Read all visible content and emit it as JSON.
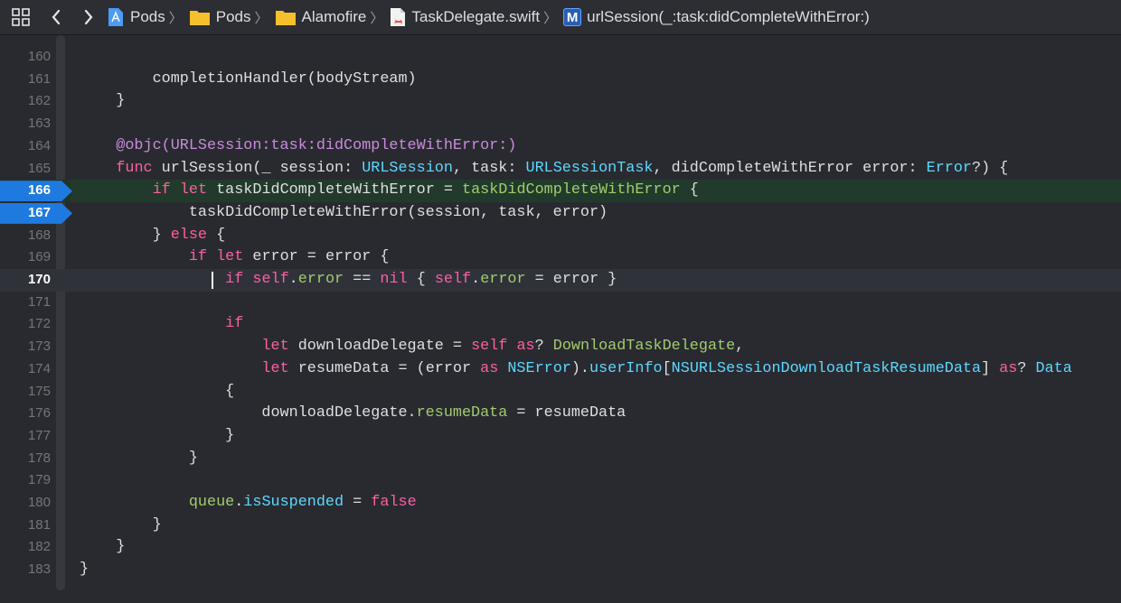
{
  "jumpbar": {
    "crumbs": [
      {
        "label": "Pods",
        "icon": "project-icon"
      },
      {
        "label": "Pods",
        "icon": "folder-icon"
      },
      {
        "label": "Alamofire",
        "icon": "folder-icon"
      },
      {
        "label": "TaskDelegate.swift",
        "icon": "swift-file-icon"
      },
      {
        "label": "urlSession(_:task:didCompleteWithError:)",
        "icon": "method-icon"
      }
    ],
    "method_badge": "M"
  },
  "colors": {
    "breakpoint": "#1f7ae0",
    "execution_line": "#223a2b",
    "background": "#292a30"
  },
  "editor": {
    "breakpoint_lines": [
      166,
      167
    ],
    "current_line": 170,
    "lines": [
      {
        "n": "160",
        "tokens": []
      },
      {
        "n": "161",
        "tokens": [
          {
            "t": "        completionHandler(bodyStream)",
            "c": ""
          }
        ]
      },
      {
        "n": "162",
        "tokens": [
          {
            "t": "    }",
            "c": ""
          }
        ]
      },
      {
        "n": "163",
        "tokens": []
      },
      {
        "n": "164",
        "tokens": [
          {
            "t": "    @objc(URLSession:task:didCompleteWithError:)",
            "c": "att"
          }
        ]
      },
      {
        "n": "165",
        "tokens": [
          {
            "t": "    ",
            "c": ""
          },
          {
            "t": "func",
            "c": "kw"
          },
          {
            "t": " urlSession(_ session: ",
            "c": ""
          },
          {
            "t": "URLSession",
            "c": "ty"
          },
          {
            "t": ", task: ",
            "c": ""
          },
          {
            "t": "URLSessionTask",
            "c": "ty"
          },
          {
            "t": ", didCompleteWithError error: ",
            "c": ""
          },
          {
            "t": "Error",
            "c": "ty"
          },
          {
            "t": "?) {",
            "c": ""
          }
        ]
      },
      {
        "n": "166",
        "tokens": [
          {
            "t": "        ",
            "c": ""
          },
          {
            "t": "if",
            "c": "kw"
          },
          {
            "t": " ",
            "c": ""
          },
          {
            "t": "let",
            "c": "kw"
          },
          {
            "t": " taskDidCompleteWithError = ",
            "c": ""
          },
          {
            "t": "taskDidCompleteWithError",
            "c": "mem"
          },
          {
            "t": " {",
            "c": ""
          }
        ]
      },
      {
        "n": "167",
        "tokens": [
          {
            "t": "            taskDidCompleteWithError(session, task, error)",
            "c": ""
          }
        ]
      },
      {
        "n": "168",
        "tokens": [
          {
            "t": "        } ",
            "c": ""
          },
          {
            "t": "else",
            "c": "kw"
          },
          {
            "t": " {",
            "c": ""
          }
        ]
      },
      {
        "n": "169",
        "tokens": [
          {
            "t": "            ",
            "c": ""
          },
          {
            "t": "if",
            "c": "kw"
          },
          {
            "t": " ",
            "c": ""
          },
          {
            "t": "let",
            "c": "kw"
          },
          {
            "t": " error = error {",
            "c": ""
          }
        ]
      },
      {
        "n": "170",
        "tokens": [
          {
            "t": "                ",
            "c": ""
          },
          {
            "t": "if",
            "c": "kw"
          },
          {
            "t": " ",
            "c": ""
          },
          {
            "t": "self",
            "c": "kw"
          },
          {
            "t": ".",
            "c": ""
          },
          {
            "t": "error",
            "c": "mem"
          },
          {
            "t": " == ",
            "c": ""
          },
          {
            "t": "nil",
            "c": "kw"
          },
          {
            "t": " { ",
            "c": ""
          },
          {
            "t": "self",
            "c": "kw"
          },
          {
            "t": ".",
            "c": ""
          },
          {
            "t": "error",
            "c": "mem"
          },
          {
            "t": " = error }",
            "c": ""
          }
        ]
      },
      {
        "n": "171",
        "tokens": []
      },
      {
        "n": "172",
        "tokens": [
          {
            "t": "                ",
            "c": ""
          },
          {
            "t": "if",
            "c": "kw"
          }
        ]
      },
      {
        "n": "173",
        "tokens": [
          {
            "t": "                    ",
            "c": ""
          },
          {
            "t": "let",
            "c": "kw"
          },
          {
            "t": " downloadDelegate = ",
            "c": ""
          },
          {
            "t": "self",
            "c": "kw"
          },
          {
            "t": " ",
            "c": ""
          },
          {
            "t": "as",
            "c": "kw"
          },
          {
            "t": "? ",
            "c": ""
          },
          {
            "t": "DownloadTaskDelegate",
            "c": "mem"
          },
          {
            "t": ",",
            "c": ""
          }
        ]
      },
      {
        "n": "174",
        "tokens": [
          {
            "t": "                    ",
            "c": ""
          },
          {
            "t": "let",
            "c": "kw"
          },
          {
            "t": " resumeData = (error ",
            "c": ""
          },
          {
            "t": "as",
            "c": "kw"
          },
          {
            "t": " ",
            "c": ""
          },
          {
            "t": "NSError",
            "c": "ty"
          },
          {
            "t": ").",
            "c": ""
          },
          {
            "t": "userInfo",
            "c": "ty"
          },
          {
            "t": "[",
            "c": ""
          },
          {
            "t": "NSURLSessionDownloadTaskResumeData",
            "c": "ty"
          },
          {
            "t": "] ",
            "c": ""
          },
          {
            "t": "as",
            "c": "kw"
          },
          {
            "t": "? ",
            "c": ""
          },
          {
            "t": "Data",
            "c": "ty"
          }
        ]
      },
      {
        "n": "175",
        "tokens": [
          {
            "t": "                {",
            "c": ""
          }
        ]
      },
      {
        "n": "176",
        "tokens": [
          {
            "t": "                    downloadDelegate.",
            "c": ""
          },
          {
            "t": "resumeData",
            "c": "mem"
          },
          {
            "t": " = resumeData",
            "c": ""
          }
        ]
      },
      {
        "n": "177",
        "tokens": [
          {
            "t": "                }",
            "c": ""
          }
        ]
      },
      {
        "n": "178",
        "tokens": [
          {
            "t": "            }",
            "c": ""
          }
        ]
      },
      {
        "n": "179",
        "tokens": []
      },
      {
        "n": "180",
        "tokens": [
          {
            "t": "            ",
            "c": ""
          },
          {
            "t": "queue",
            "c": "mem"
          },
          {
            "t": ".",
            "c": ""
          },
          {
            "t": "isSuspended",
            "c": "ty"
          },
          {
            "t": " = ",
            "c": ""
          },
          {
            "t": "false",
            "c": "kw"
          }
        ]
      },
      {
        "n": "181",
        "tokens": [
          {
            "t": "        }",
            "c": ""
          }
        ]
      },
      {
        "n": "182",
        "tokens": [
          {
            "t": "    }",
            "c": ""
          }
        ]
      },
      {
        "n": "183",
        "tokens": [
          {
            "t": "}",
            "c": ""
          }
        ]
      }
    ]
  }
}
